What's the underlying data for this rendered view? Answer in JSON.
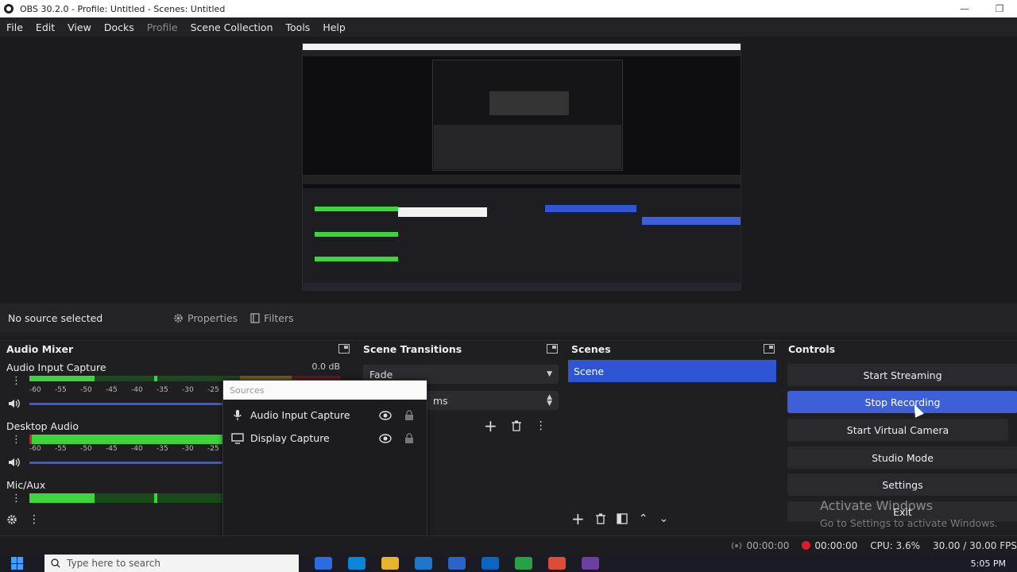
{
  "window": {
    "title": "OBS 30.2.0 - Profile: Untitled - Scenes: Untitled",
    "minimize": "—",
    "maximize": "❐"
  },
  "menu": {
    "items": [
      "File",
      "Edit",
      "View",
      "Docks",
      "Profile",
      "Scene Collection",
      "Tools",
      "Help"
    ]
  },
  "source_bar": {
    "no_source": "No source selected",
    "properties": "Properties",
    "filters": "Filters"
  },
  "audio_mixer": {
    "title": "Audio Mixer",
    "channels": [
      {
        "name": "Audio Input Capture",
        "db": "0.0 dB"
      },
      {
        "name": "Desktop Audio",
        "db": ""
      },
      {
        "name": "Mic/Aux",
        "db": ""
      }
    ],
    "ticks": [
      "-60",
      "-55",
      "-50",
      "-45",
      "-40",
      "-35",
      "-30",
      "-25"
    ]
  },
  "sources": {
    "title": "Sources",
    "items": [
      {
        "name": "Audio Input Capture",
        "icon": "microphone-icon"
      },
      {
        "name": "Display Capture",
        "icon": "monitor-icon"
      }
    ]
  },
  "scene_transitions": {
    "title": "Scene Transitions",
    "transition": "Fade",
    "duration_suffix": "ms"
  },
  "scenes": {
    "title": "Scenes",
    "items": [
      "Scene"
    ]
  },
  "controls": {
    "title": "Controls",
    "buttons": [
      "Start Streaming",
      "Stop Recording",
      "Start Virtual Camera",
      "Studio Mode",
      "Settings",
      "Exit"
    ]
  },
  "watermark": {
    "line1": "Activate Windows",
    "line2": "Go to Settings to activate Windows."
  },
  "status": {
    "stream_time": "00:00:00",
    "rec_time": "00:00:00",
    "cpu": "CPU: 3.6%",
    "fps": "30.00 / 30.00 FPS"
  },
  "taskbar": {
    "search_placeholder": "Type here to search",
    "clock": "5:05 PM"
  },
  "colors": {
    "accent": "#3d5fd8",
    "meter_green": "#3ed43e",
    "record_red": "#e01b24"
  }
}
